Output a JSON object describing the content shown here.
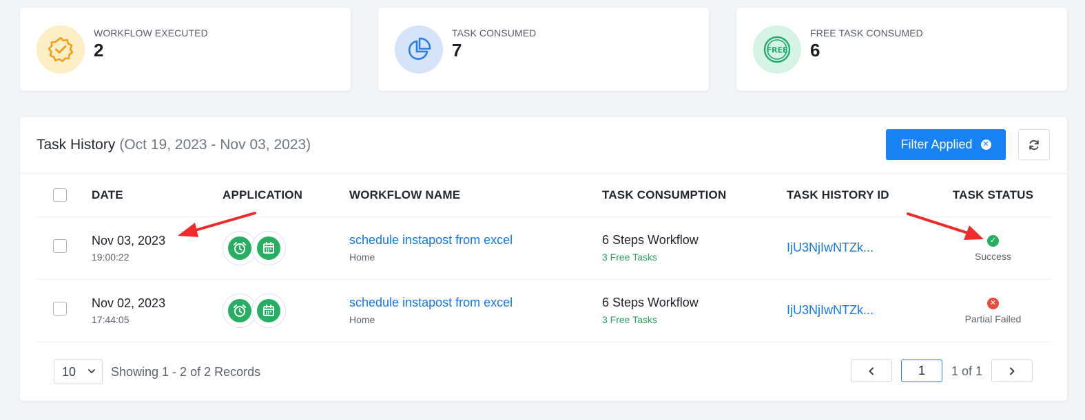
{
  "stats": [
    {
      "label": "WORKFLOW EXECUTED",
      "value": "2",
      "icon": "badge-check-icon",
      "bg": "#fdeec5",
      "color": "#f39c12"
    },
    {
      "label": "TASK CONSUMED",
      "value": "7",
      "icon": "pie-chart-icon",
      "bg": "#d5e4fb",
      "color": "#2a7de1"
    },
    {
      "label": "FREE TASK CONSUMED",
      "value": "6",
      "icon": "free-badge-icon",
      "bg": "#d4f3e5",
      "color": "#22a96c"
    }
  ],
  "panel": {
    "title": "Task History",
    "date_range": "(Oct 19, 2023 - Nov 03, 2023)",
    "filter_label": "Filter Applied",
    "refresh_icon": "refresh-icon"
  },
  "table": {
    "headers": {
      "date": "DATE",
      "application": "APPLICATION",
      "workflow": "WORKFLOW NAME",
      "consumption": "TASK CONSUMPTION",
      "history_id": "TASK HISTORY ID",
      "status": "TASK STATUS"
    },
    "rows": [
      {
        "date": "Nov 03, 2023",
        "time": "19:00:22",
        "apps": [
          "alarm-clock-icon",
          "calendar-icon"
        ],
        "workflow": "schedule instapost from excel",
        "folder": "Home",
        "consumption": "6 Steps Workflow",
        "free_tasks": "3 Free Tasks",
        "history_id": "IjU3NjIwNTZk...",
        "status": "Success",
        "status_color": "#27ae60"
      },
      {
        "date": "Nov 02, 2023",
        "time": "17:44:05",
        "apps": [
          "alarm-clock-icon",
          "calendar-icon"
        ],
        "workflow": "schedule instapost from excel",
        "folder": "Home",
        "consumption": "6 Steps Workflow",
        "free_tasks": "3 Free Tasks",
        "history_id": "IjU3NjIwNTZk...",
        "status": "Partial Failed",
        "status_color": "#e74c3c"
      }
    ]
  },
  "footer": {
    "per_page": "10",
    "records_text": "Showing 1 - 2 of 2 Records",
    "current_page": "1",
    "page_of": "1 of 1"
  }
}
